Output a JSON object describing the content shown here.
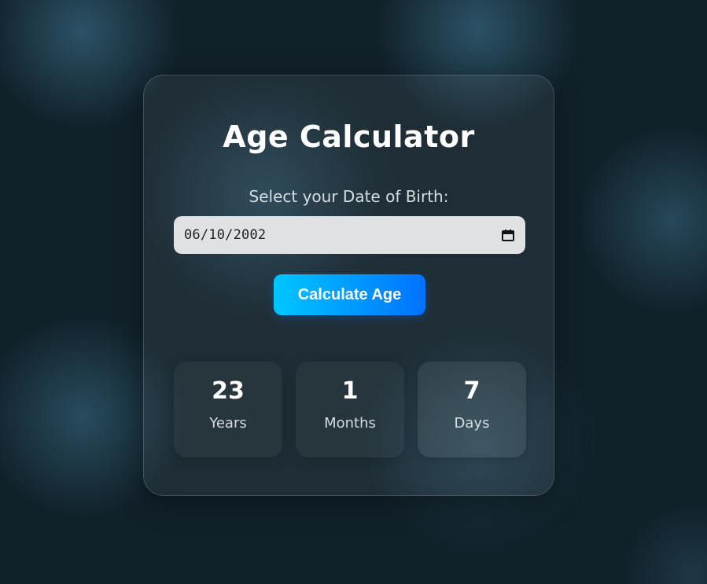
{
  "app": {
    "title": "Age Calculator"
  },
  "form": {
    "dob_label": "Select your Date of Birth:",
    "dob_value": "06/10/2002",
    "calendar_icon": "calendar-icon",
    "calculate_label": "Calculate Age"
  },
  "results": [
    {
      "value": "23",
      "unit": "Years"
    },
    {
      "value": "1",
      "unit": "Months"
    },
    {
      "value": "7",
      "unit": "Days"
    }
  ],
  "colors": {
    "background": "#11212a",
    "button_gradient_start": "#00c6ff",
    "button_gradient_end": "#0072ff",
    "input_background": "#dfe1e3",
    "text_primary": "#ffffff",
    "text_secondary": "#d6dde1"
  }
}
